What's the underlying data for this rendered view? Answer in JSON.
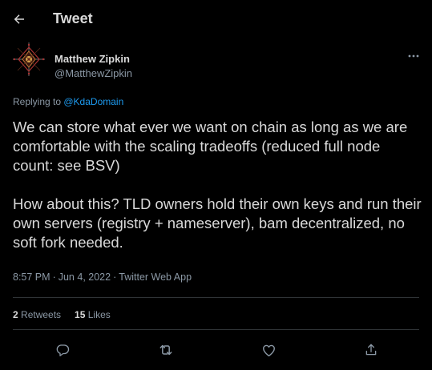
{
  "header": {
    "title": "Tweet",
    "back_icon": "arrow-left-icon"
  },
  "author": {
    "name": "Matthew Zipkin",
    "handle": "@MatthewZipkin",
    "avatar": "avatar-image"
  },
  "reply": {
    "prefix": "Replying to ",
    "mention": "@KdaDomain"
  },
  "tweet": {
    "paragraphs": [
      "We can store what ever we want on chain as long as we are comfortable with the scaling tradeoffs (reduced full node count: see BSV)",
      "How about this? TLD owners hold their own keys and run their own servers (registry + nameserver), bam decentralized, no soft fork needed."
    ],
    "time": "8:57 PM",
    "date": "Jun 4, 2022",
    "source": "Twitter Web App",
    "separator": "·"
  },
  "stats": {
    "retweets_count": "2",
    "retweets_label": " Retweets",
    "likes_count": "15",
    "likes_label": " Likes"
  },
  "actions": [
    "reply-icon",
    "retweet-icon",
    "like-icon",
    "share-icon"
  ],
  "colors": {
    "background": "#000000",
    "text": "#d9d9d9",
    "muted": "#8b98a5",
    "accent": "#1d9bf0",
    "divider": "#2f3336"
  }
}
